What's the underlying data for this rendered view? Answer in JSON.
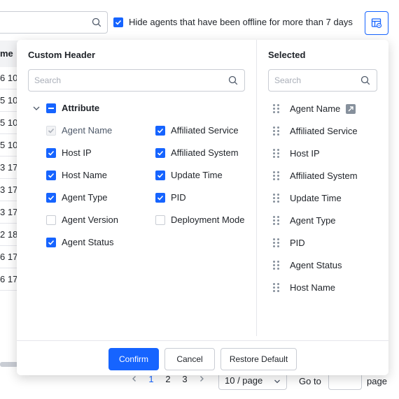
{
  "toolbar": {
    "search_placeholder": "",
    "hide_offline_label": "Hide agents that have been offline for more than 7 days",
    "hide_offline_checked": true
  },
  "table": {
    "header_fragment": "me",
    "cells": [
      "6 10",
      "5 10",
      "5 10",
      "5 10",
      "3 17",
      "3 17",
      "3 17",
      "2 18",
      "6 17",
      "6 17"
    ]
  },
  "pagination": {
    "prev_icon": "chevron-left-icon",
    "pages": [
      "1",
      "2",
      "3"
    ],
    "active_page": "1",
    "next_icon": "chevron-right-icon",
    "page_size": "10 / page",
    "goto_label": "Go to",
    "page_label": "page"
  },
  "popover": {
    "custom_header_title": "Custom Header",
    "search_placeholder": "Search",
    "group_label": "Attribute",
    "options": [
      {
        "label": "Agent Name",
        "checked": true,
        "disabled": true
      },
      {
        "label": "Affiliated Service",
        "checked": true,
        "disabled": false
      },
      {
        "label": "Host IP",
        "checked": true,
        "disabled": false
      },
      {
        "label": "Affiliated System",
        "checked": true,
        "disabled": false
      },
      {
        "label": "Host Name",
        "checked": true,
        "disabled": false
      },
      {
        "label": "Update Time",
        "checked": true,
        "disabled": false
      },
      {
        "label": "Agent Type",
        "checked": true,
        "disabled": false
      },
      {
        "label": "PID",
        "checked": true,
        "disabled": false
      },
      {
        "label": "Agent Version",
        "checked": false,
        "disabled": false
      },
      {
        "label": "Deployment Mode",
        "checked": false,
        "disabled": false
      },
      {
        "label": "Agent Status",
        "checked": true,
        "disabled": false
      }
    ],
    "selected_title": "Selected",
    "selected_search_placeholder": "Search",
    "selected_items": [
      "Agent Name",
      "Affiliated Service",
      "Host IP",
      "Affiliated System",
      "Update Time",
      "Agent Type",
      "PID",
      "Agent Status",
      "Host Name"
    ],
    "pinned_item": "Agent Name",
    "confirm_label": "Confirm",
    "cancel_label": "Cancel",
    "restore_label": "Restore Default"
  },
  "colors": {
    "accent": "#1664ff",
    "border": "#c9cdd4",
    "muted": "#86909c"
  }
}
